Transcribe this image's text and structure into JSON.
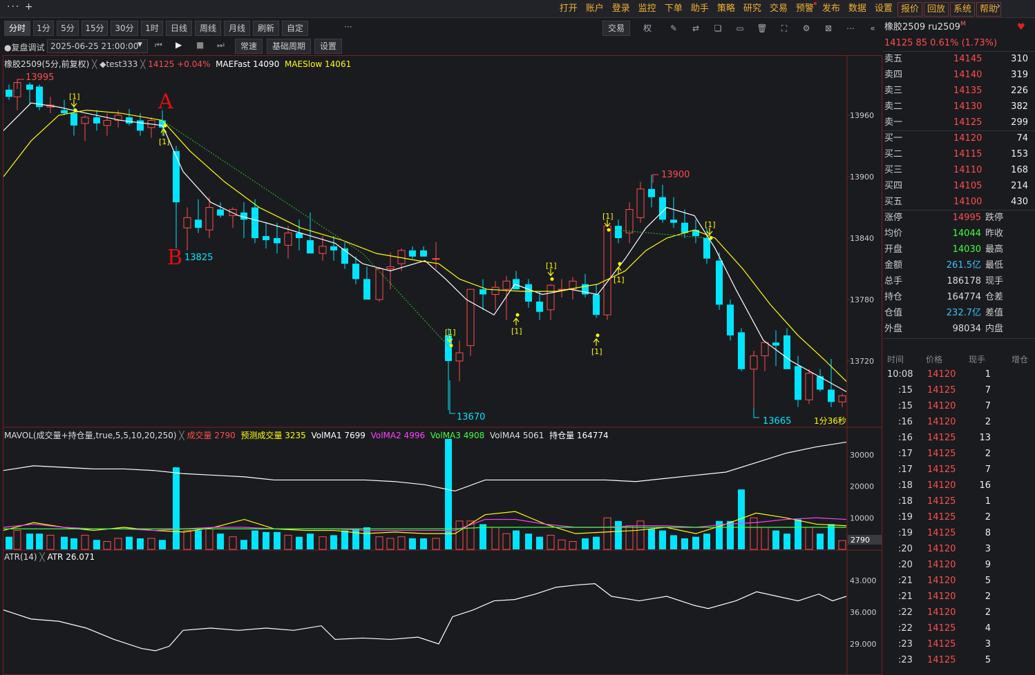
{
  "topbar": {
    "left_glyphs": "··· +",
    "menu": [
      "打开",
      "账户",
      "登录",
      "监控",
      "下单",
      "助手",
      "策略",
      "研究",
      "交易",
      "预警",
      "发布",
      "数据",
      "设置"
    ],
    "boxed": [
      "报价",
      "回放",
      "系统",
      "帮助"
    ]
  },
  "toolbar": {
    "periods": [
      "分时",
      "1分",
      "5分",
      "15分",
      "30分",
      "1时",
      "日线",
      "周线",
      "月线",
      "刷新",
      "自定"
    ],
    "more": "···",
    "trade": "交易",
    "quan": "权"
  },
  "replay": {
    "label": "●复盘调试",
    "datetime": "2025-06-25 21:00:00",
    "speed": "常速",
    "base": "基础周期",
    "settings": "设置"
  },
  "main": {
    "title": "橡胶2509(5分,前复权)",
    "strat": "◆test333",
    "price": "14125 +0.04%",
    "fast": "MAEFast 14090",
    "slow": "MAESlow 14061",
    "y_ticks": [
      "13960",
      "13900",
      "13840",
      "13780",
      "13720"
    ],
    "labels": {
      "high1": "13995",
      "low1": "13825",
      "low2": "13670",
      "high2": "13900",
      "low3": "13665",
      "timer": "1分36秒",
      "A": "A",
      "B": "B",
      "sig": "[1]"
    },
    "colors": {
      "up": "#ff4d4d",
      "down": "#00e5ff",
      "white": "#ffffff",
      "yellow": "#ffff00"
    }
  },
  "vol": {
    "title": "MAVOL(成交量+持仓量,true,5,5,10,20,250)",
    "cj": "成交量 2790",
    "yc": "预测成交量 3235",
    "ma1": "VolMA1 7699",
    "ma2": "VolMA2 4996",
    "ma3": "VolMA3 4908",
    "ma4": "VolMA4 5061",
    "cc": "持仓量 164774",
    "y_ticks": [
      "30000",
      "20000",
      "10000"
    ],
    "cur": "2790"
  },
  "atr": {
    "title": "ATR(14)",
    "value": "ATR 26.071",
    "y_ticks": [
      "43.000",
      "36.000",
      "29.000"
    ]
  },
  "quote": {
    "title": "橡胶2509 ru2509",
    "sup": "M",
    "change": "14125  85  0.61%  (1.73%)",
    "asks": [
      [
        "卖五",
        "14145",
        "310"
      ],
      [
        "卖四",
        "14140",
        "319"
      ],
      [
        "卖三",
        "14135",
        "226"
      ],
      [
        "卖二",
        "14130",
        "382"
      ],
      [
        "卖一",
        "14125",
        "299"
      ]
    ],
    "bids": [
      [
        "买一",
        "14120",
        "74"
      ],
      [
        "买二",
        "14115",
        "153"
      ],
      [
        "买三",
        "14110",
        "168"
      ],
      [
        "买四",
        "14105",
        "214"
      ],
      [
        "买五",
        "14100",
        "430"
      ]
    ],
    "stats": [
      [
        "涨停",
        "14995",
        "跌停"
      ],
      [
        "均价",
        "14044",
        "昨收"
      ],
      [
        "开盘",
        "14030",
        "最高"
      ],
      [
        "金额",
        "261.5亿",
        "最低"
      ],
      [
        "总手",
        "186178",
        "现手"
      ],
      [
        "持仓",
        "164774",
        "仓差"
      ],
      [
        "仓值",
        "232.7亿",
        "差值"
      ],
      [
        "外盘",
        "98034",
        "内盘"
      ]
    ],
    "ticks_header": [
      "时间",
      "价格",
      "现手",
      "增仓"
    ],
    "ticks": [
      [
        "10:08",
        "14120",
        "1"
      ],
      [
        ":15",
        "14125",
        "7"
      ],
      [
        ":15",
        "14120",
        "7"
      ],
      [
        ":16",
        "14120",
        "2"
      ],
      [
        ":16",
        "14125",
        "13"
      ],
      [
        ":17",
        "14125",
        "2"
      ],
      [
        ":17",
        "14125",
        "7"
      ],
      [
        ":18",
        "14120",
        "16"
      ],
      [
        ":18",
        "14125",
        "1"
      ],
      [
        ":19",
        "14125",
        "2"
      ],
      [
        ":19",
        "14125",
        "8"
      ],
      [
        ":20",
        "14120",
        "3"
      ],
      [
        ":20",
        "14120",
        "9"
      ],
      [
        ":21",
        "14120",
        "5"
      ],
      [
        ":21",
        "14120",
        "2"
      ],
      [
        ":22",
        "14120",
        "2"
      ],
      [
        ":22",
        "14125",
        "4"
      ],
      [
        ":23",
        "14125",
        "3"
      ],
      [
        ":23",
        "14125",
        "5"
      ]
    ]
  }
}
